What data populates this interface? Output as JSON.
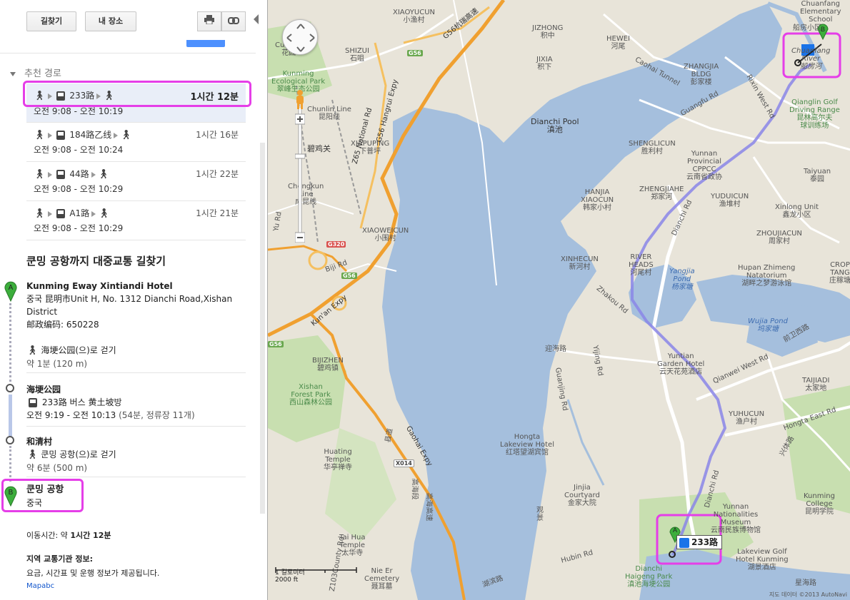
{
  "toolbar": {
    "directions_label": "길찾기",
    "my_places_label": "내 장소",
    "print_icon": "printer-icon",
    "link_icon": "link-icon"
  },
  "recommended_header": "추천 경로",
  "routes": [
    {
      "line": "233路",
      "duration": "1시간 12분",
      "times": "오전 9:08 - 오전 10:19",
      "selected": true
    },
    {
      "line": "184路乙线",
      "duration": "1시간 16분",
      "times": "오전 9:08 - 오전 10:24",
      "selected": false
    },
    {
      "line": "44路",
      "duration": "1시간 22분",
      "times": "오전 9:08 - 오전 10:29",
      "selected": false
    },
    {
      "line": "A1路",
      "duration": "1시간 21분",
      "times": "오전 9:08 - 오전 10:29",
      "selected": false
    }
  ],
  "directions_title": "쿤밍 공항까지 대중교통 길찾기",
  "start": {
    "pin": "A",
    "name": "Kunming Eway Xintiandi Hotel",
    "addr1": "중국 昆明市Unit H, No. 1312 Dianchi Road,Xishan",
    "addr2": "District",
    "addr3": "邮政编码: 650228"
  },
  "walk1": {
    "text": "海埂公园(으)로 걷기",
    "sub": "약 1분 (120 m)"
  },
  "stop1": {
    "name": "海埂公园",
    "bus": "233路 버스 黄土坡방",
    "times": "오전 9:19 - 오전 10:13",
    "extra": "(54분, 정류장 11개)"
  },
  "stop2": {
    "name": "和清村",
    "walk": "쿤밍 공항(으)로 걷기",
    "sub": "약 6분 (500 m)"
  },
  "end": {
    "pin": "B",
    "name": "쿤밍 공항",
    "country": "중국"
  },
  "footer": {
    "travel_time_prefix": "이동시간: 약 ",
    "travel_time_value": "1시간 12분",
    "agency_title": "지역 교통기관 정보:",
    "agency_text": "요금, 시간표 및 운행 정보가 제공됩니다.",
    "agency_link": "Mapabc"
  },
  "map": {
    "route_badge": "233路",
    "scale_metric": "1 킬로미터",
    "scale_imperial": "2000 ft",
    "copyright": "지도 데이터 ©2013 AutoNavi",
    "colors": {
      "water": "#a5bfdd",
      "land": "#e8e4d9",
      "green": "#c8dfb0",
      "highway": "#f0a030",
      "route": "#8a86e8",
      "highlight": "#e53ee8"
    },
    "labels": {
      "xiaoyucun": "XIAOYUCUN",
      "xiaoyucun_cn": "小渔村",
      "jizhong": "JIZHONG",
      "jizhong_cn": "积中",
      "hewei": "HEWEI",
      "hewei_cn": "河尾",
      "jixia": "JIXIA",
      "jixia_cn": "积下",
      "shizui": "SHIZUI",
      "shizui_cn": "石咀",
      "caohai": "Caohai Tunnel",
      "zhangjia": "ZHANGJIA",
      "zhangjia2": "BLDG",
      "zhangjia_cn": "彭家楼",
      "guangfu": "Guangfu Rd",
      "rixin": "Rixin West Rd",
      "chuanfang_cn": "船房小区",
      "chuanfang_river1": "Chuanfang",
      "chuanfang_river2": "River",
      "chuanfang_river_cn": "船房河",
      "elementary1": "Chuanfang",
      "elementary2": "Elementary",
      "elementary3": "School",
      "qianglin1": "Qianglin Golf",
      "qianglin2": "Driving Range",
      "qianglin3": "昆林高尔夫",
      "qianglin4": "球训练场",
      "kunming_park1": "Kunming",
      "kunming_park2": "Ecological Park",
      "kunming_park3": "翠峰生态公园",
      "huifeng": "Cuifeng",
      "huifeng_cn": "花园",
      "line1": "Line",
      "line1b": "Chunlin Line",
      "line1_cn": "昆阳线",
      "bijiguan": "碧鸡关",
      "xiapuping": "XIAPUPING",
      "xiapuping_cn": "下普坪",
      "dianchi": "Dianchi Pool",
      "dianchi_cn": "滇池",
      "shenglicun": "SHENGLICUN",
      "shenglicun_cn": "胜利村",
      "yunnan1": "Yunnan",
      "yunnan2": "Provincial",
      "yunnan3": "CPPCC",
      "yunnan4": "云南省政协",
      "taiyuan": "Taiyuan",
      "taiyuan_cn": "泰园",
      "xinlong": "Xinlong Unit",
      "xinlong_cn": "鑫龙小区",
      "hanjia": "HANJIA",
      "hanjia2": "XIAOCUN",
      "hanjia_cn": "韩家小村",
      "zhengjiahe": "ZHENGJIAHE",
      "zhengjiahe_cn": "郑家河",
      "yuduicun": "YUDUICUN",
      "yuduicun_cn": "渔堆村",
      "chengkun": "Chengkun",
      "chengkun2": "Line",
      "chengkun_cn": "成昆线",
      "xiaoweicun": "XIAOWEICUN",
      "xiaoweicun_cn": "小围村",
      "zhoujiacun": "ZHOUJIACUN",
      "zhoujiacun_cn": "周家村",
      "crop1": "CROP",
      "crop2": "TANG",
      "crop_cn": "庄稼塘",
      "g320": "G320",
      "g56a": "G56",
      "g56b": "G56",
      "g56c": "G56",
      "xinhecun": "XINHECUN",
      "xinhecun_cn": "新河村",
      "riverhead1": "RIVER",
      "riverhead2": "HEADS",
      "riverhead_cn": "河尾村",
      "yangjia": "Yangjia",
      "yangjia2": "Pond",
      "yangjia_cn": "杨家塘",
      "hupan1": "Hupan Zhimeng",
      "hupan2": "Natatorium",
      "hupan_cn": "湖畔之梦游泳馆",
      "wujia": "Wujia Pond",
      "wujia_cn": "坞家塘",
      "biji": "Biji Rd",
      "kunan": "Kun'an Expy",
      "zhakou": "Zhakou Rd",
      "dianchi_rd": "Dianchi Rd",
      "dianchi_rd2": "Dianchi Rd",
      "yingxi": "迎海路",
      "guanjing": "Guanjing Rd",
      "yijing": "Yijing Rd",
      "yuntian1": "Yuntian",
      "yuntian2": "Garden Hotel",
      "yuntian_cn": "云天花苑酒店",
      "qianwei": "Qianwei West Rd",
      "qianwei_cn": "前卫西路",
      "taijiadi": "TAIJIADI",
      "taijiadi_cn": "太家地",
      "bijizhen": "BIJIZHEN",
      "bijizhen_cn": "碧鸡镇",
      "xishan1": "Xishan",
      "xishan2": "Forest Park",
      "xishan_cn": "西山森林公园",
      "yuhucun": "YUHUCUN",
      "yuhucun_cn": "渔户村",
      "hongta": "Hongta East Rd",
      "xingbei": "兴体路",
      "hongta_hotel1": "Hongta",
      "hongta_hotel2": "Lakeview Hotel",
      "hongta_hotel_cn": "红塔望湖宾馆",
      "huating1": "Huating",
      "huating2": "Temple",
      "huating_cn": "华亭禅寺",
      "x014": "X014",
      "gaohai": "Gaohai Expy",
      "gaohai_cn": "高海高速",
      "gaolu": "高海段",
      "jinjia1": "Jinjia",
      "jinjia2": "Courtyard",
      "jinjia_cn": "金家大院",
      "guan": "观",
      "jing": "景",
      "kunming_college1": "Kunming",
      "kunming_college2": "College",
      "kunming_college_cn": "昆明学院",
      "museum1": "Yunnan",
      "museum2": "Nationalities",
      "museum3": "Museum",
      "museum_cn": "云南民族博物馆",
      "taihua1": "Tai Hua",
      "taihua2": "Temple",
      "taihua_cn": "太华寺",
      "lakeview_golf1": "Lakeview Golf",
      "lakeview_golf2": "Hotel Kunming",
      "lakeview_golf_cn": "湖景酒店",
      "nieer1": "Nie Er",
      "nieer2": "Cemetery",
      "nieer_cn": "聂耳墓",
      "haigeng1": "Dianchi",
      "haigeng2": "Haigeng Park",
      "haigeng_cn": "滇池海埂公园",
      "hubin": "Hubin Rd",
      "hubin_cn": "湖滨路",
      "xinghai": "星海路",
      "xishan_rd": "Z103County Rd",
      "xianzhi": "县道",
      "yuanlu": "Yu Rd",
      "chicun": "赤村",
      "z65": "Z65 National Rd",
      "g56expy": "G56 Hangrui Expy",
      "g56top": "G56杭瑞高速"
    }
  }
}
